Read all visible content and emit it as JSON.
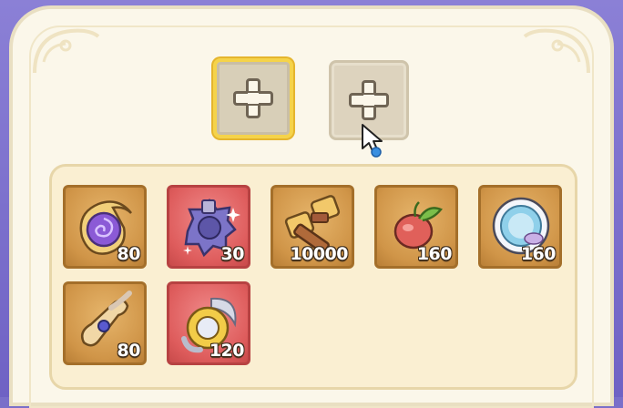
{
  "equip_slots": [
    {
      "name": "slot-1",
      "state": "selected",
      "icon": "plus-icon"
    },
    {
      "name": "slot-2",
      "state": "empty",
      "icon": "plus-icon"
    }
  ],
  "inventory": {
    "items": [
      {
        "icon": "purple-swirl-amulet-icon",
        "count": "80",
        "rarity": "gold"
      },
      {
        "icon": "sparkling-gear-ore-icon",
        "count": "30",
        "rarity": "red"
      },
      {
        "icon": "wooden-hammer-icon",
        "count": "10000",
        "rarity": "gold"
      },
      {
        "icon": "fruit-sprout-icon",
        "count": "160",
        "rarity": "gold"
      },
      {
        "icon": "crystal-orb-icon",
        "count": "160",
        "rarity": "gold"
      },
      {
        "icon": "scroll-bundle-icon",
        "count": "80",
        "rarity": "gold"
      },
      {
        "icon": "golden-ring-feather-icon",
        "count": "120",
        "rarity": "red"
      }
    ]
  },
  "colors": {
    "frame": "#7a6fc9",
    "panel": "#fbf7ea",
    "selected_border": "#f5d34a",
    "gold_tile": "#d09548",
    "red_tile": "#de5c5c"
  }
}
